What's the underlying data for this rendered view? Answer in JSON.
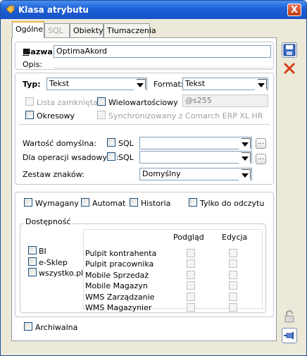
{
  "window": {
    "title": "Klasa atrybutu",
    "close_label": "X"
  },
  "tabs": [
    {
      "label": "Ogólne"
    },
    {
      "label": "SQL"
    },
    {
      "label": "Obiekty"
    },
    {
      "label": "Tłumaczenia"
    }
  ],
  "basic": {
    "name_label": "Nazwa:",
    "name_value": "OptimaAkord",
    "desc_label": "Opis:",
    "desc_value": ""
  },
  "type_group": {
    "type_label": "Typ:",
    "type_value": "Tekst",
    "format_label": "Format:",
    "format_value": "Tekst",
    "closed_list_label": "Lista zamknięta",
    "multivalue_label": "Wielowartościowy",
    "format_mask": "@s255",
    "periodic_label": "Okresowy",
    "sync_label": "Synchronizowany z Comarch ERP XL HR"
  },
  "defaults": {
    "default_label": "Wartość domyślna:",
    "batch_label": "Dla operacji wsadowych:",
    "sql_label": "SQL",
    "dots_label": "...",
    "default_value": "",
    "batch_value": "",
    "charset_label": "Zestaw znaków:",
    "charset_value": "Domyślny"
  },
  "flags": {
    "required": "Wymagany",
    "auto": "Automat",
    "history": "Historia",
    "readonly": "Tylko do odczytu"
  },
  "availability": {
    "title": "Dostępność",
    "sources": [
      "BI",
      "e-Sklep",
      "wszystko.pl"
    ],
    "col_preview": "Podgląd",
    "col_edit": "Edycja",
    "rows": [
      "Pulpit kontrahenta",
      "Pulpit pracownika",
      "Mobile Sprzedaż",
      "Mobile Magazyn",
      "WMS Zarządzanie",
      "WMS Magazynier"
    ]
  },
  "archive_label": "Archiwalna",
  "colors": {
    "titlebar": "#1b5fd6",
    "window_bg": "#ece9d8",
    "close_red": "#d63a17",
    "tab_highlight": "#f0b34a"
  }
}
